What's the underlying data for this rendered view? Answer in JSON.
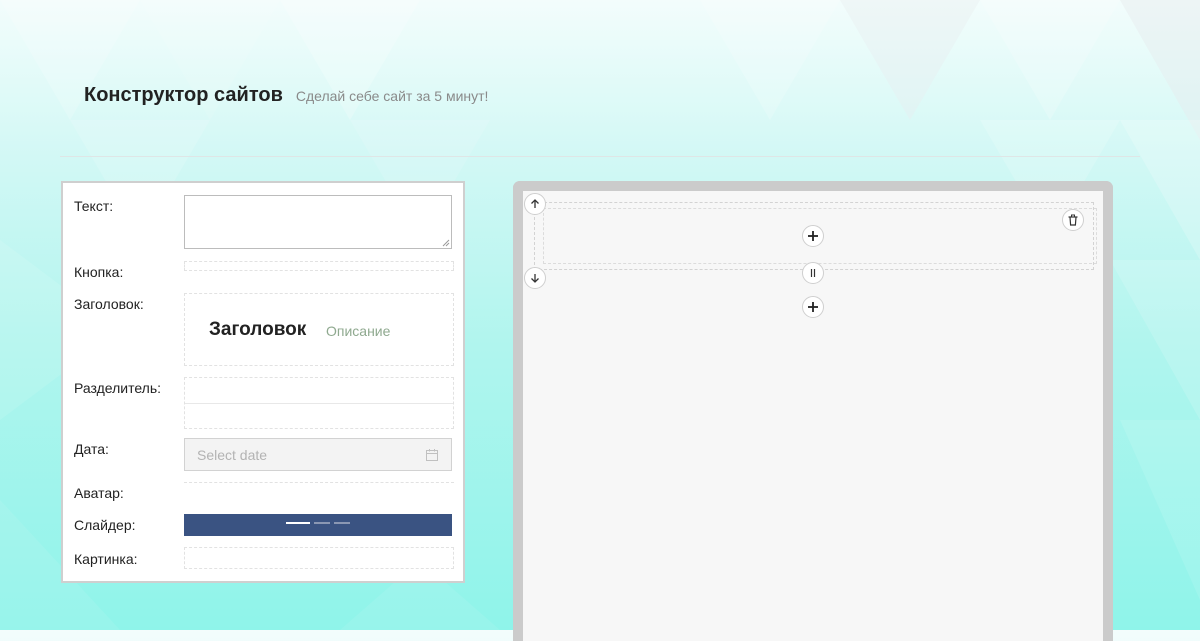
{
  "header": {
    "title": "Конструктор сайтов",
    "subtitle": "Сделай себе сайт за 5 минут!"
  },
  "components": {
    "text_label": "Текст:",
    "button_label": "Кнопка:",
    "heading_label": "Заголовок:",
    "heading_preview": {
      "title": "Заголовок",
      "description": "Описание"
    },
    "divider_label": "Разделитель:",
    "date_label": "Дата:",
    "date_placeholder": "Select date",
    "avatar_label": "Аватар:",
    "slider_label": "Слайдер:",
    "image_label": "Картинка:"
  },
  "slider": {
    "total_dots": 3,
    "active_dot": 1
  },
  "colors": {
    "slider_background": "#3a5382",
    "heading_description": "#8fa98f"
  },
  "icons": {
    "move_up": "arrow-up-icon",
    "move_down": "arrow-down-icon",
    "delete": "trash-icon",
    "add": "plus-icon",
    "pause": "pause-icon",
    "calendar": "calendar-icon"
  }
}
